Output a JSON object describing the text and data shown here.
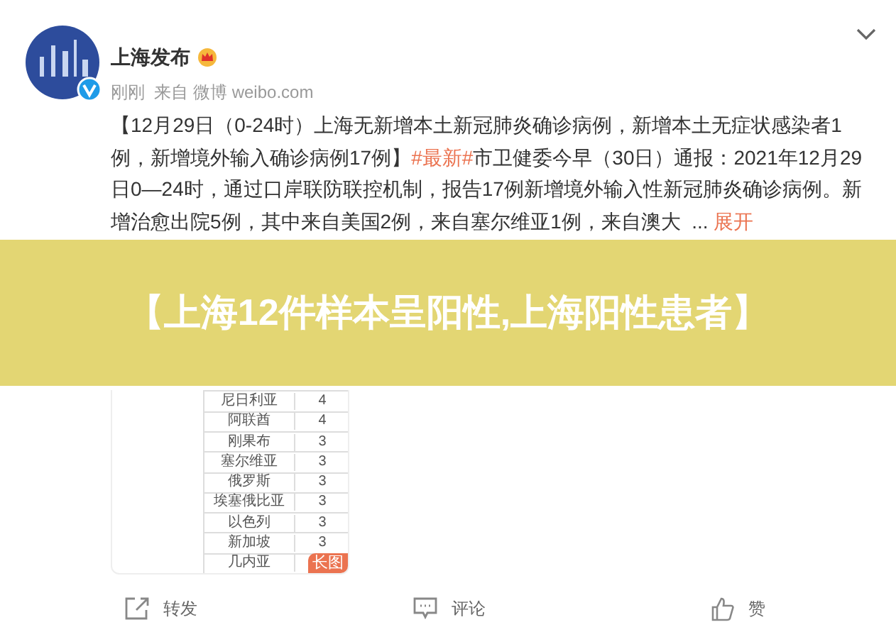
{
  "post": {
    "author": "上海发布",
    "verified": true,
    "meta": "刚刚  来自 微博 weibo.com",
    "text": [
      {
        "kind": "text",
        "text": "【12月29日（0-24时）上海无新增本土新冠肺炎确诊病例，新增本土无症状感染者1例，新增境外输入确诊病例17例】"
      },
      {
        "kind": "topic",
        "text": "#最新#"
      },
      {
        "kind": "text",
        "text": "市卫健委今早（30日）通报：2021年12月29日0—24时，通过口岸联防联控机制，报告17例新增境外输入性新冠肺炎确诊病例。新增治愈出院5例，其中来自美国2例，来自塞尔维亚1例，来自澳大  ..."
      }
    ],
    "expand_link": "展开",
    "image": {
      "badge": "长图",
      "rows": [
        {
          "country": "尼日利亚",
          "count": "4"
        },
        {
          "country": "阿联酋",
          "count": "4"
        },
        {
          "country": "刚果布",
          "count": "3"
        },
        {
          "country": "塞尔维亚",
          "count": "3"
        },
        {
          "country": "俄罗斯",
          "count": "3"
        },
        {
          "country": "埃塞俄比亚",
          "count": "3"
        },
        {
          "country": "以色列",
          "count": "3"
        },
        {
          "country": "新加坡",
          "count": "3"
        },
        {
          "country": "几内亚",
          "count": ""
        }
      ]
    }
  },
  "banner": {
    "title": "【上海12件样本呈阳性,上海阳性患者】"
  },
  "actions": [
    {
      "kind": "repost",
      "label": "转发"
    },
    {
      "kind": "comment",
      "label": "评论"
    },
    {
      "kind": "like",
      "label": "赞"
    }
  ]
}
